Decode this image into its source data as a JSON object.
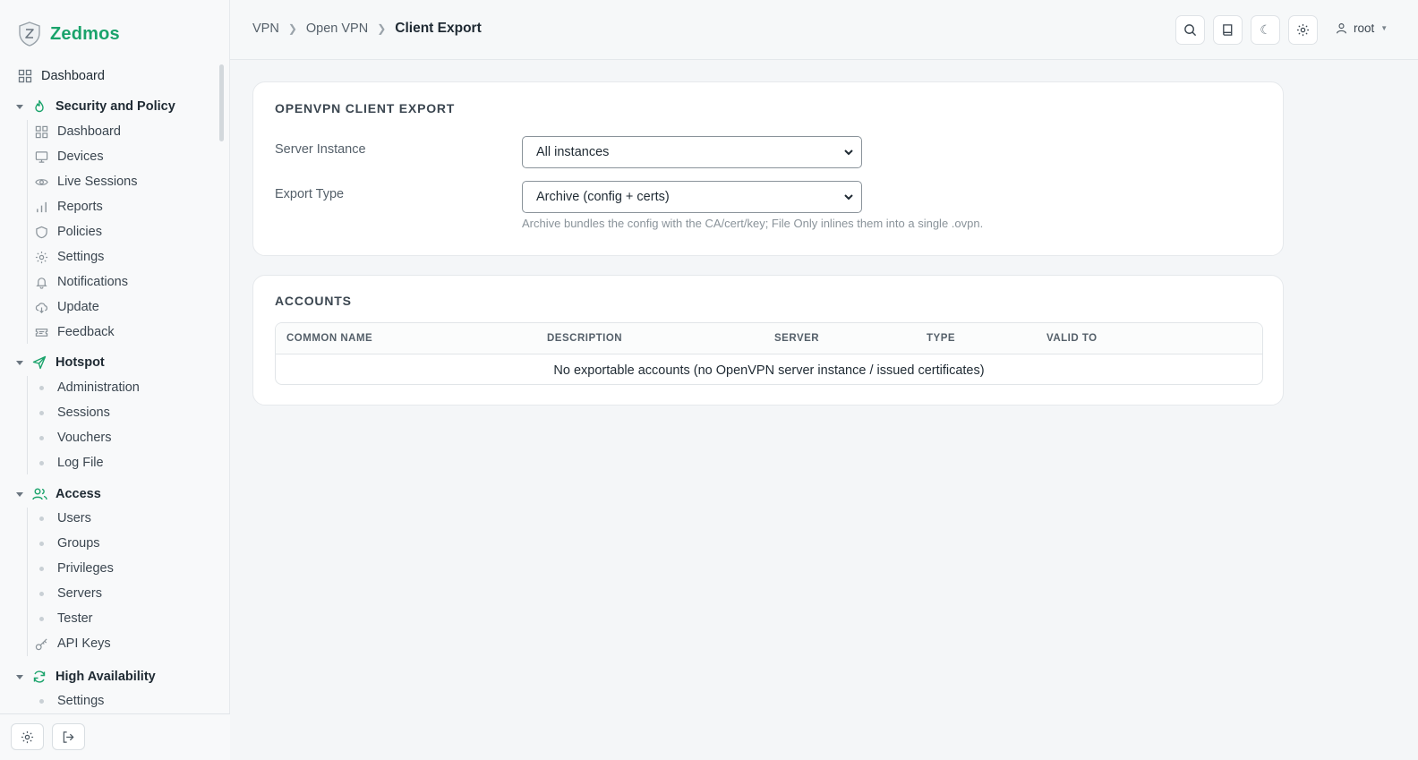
{
  "brand": {
    "name": "Zedmos"
  },
  "sidebar": {
    "top_item": "Dashboard",
    "sections": [
      {
        "label": "Security and Policy",
        "items": [
          "Dashboard",
          "Devices",
          "Live Sessions",
          "Reports",
          "Policies",
          "Settings",
          "Notifications",
          "Update",
          "Feedback"
        ]
      },
      {
        "label": "Hotspot",
        "items": [
          "Administration",
          "Sessions",
          "Vouchers",
          "Log File"
        ]
      },
      {
        "label": "Access",
        "items": [
          "Users",
          "Groups",
          "Privileges",
          "Servers",
          "Tester",
          "API Keys"
        ]
      },
      {
        "label": "High Availability",
        "items": [
          "Settings"
        ]
      }
    ]
  },
  "header": {
    "breadcrumb": [
      "VPN",
      "Open VPN",
      "Client Export"
    ],
    "user": "root"
  },
  "export_card": {
    "title": "OPENVPN CLIENT EXPORT",
    "server_instance_label": "Server Instance",
    "server_instance_value": "All instances",
    "export_type_label": "Export Type",
    "export_type_value": "Archive (config + certs)",
    "export_type_hint": "Archive bundles the config with the CA/cert/key; File Only inlines them into a single .ovpn."
  },
  "accounts_card": {
    "title": "ACCOUNTS",
    "columns": [
      "COMMON NAME",
      "DESCRIPTION",
      "SERVER",
      "TYPE",
      "VALID TO"
    ],
    "empty_message": "No exportable accounts (no OpenVPN server instance / issued certificates)"
  },
  "colors": {
    "accent": "#1aa36b",
    "background": "#f4f6f8"
  }
}
